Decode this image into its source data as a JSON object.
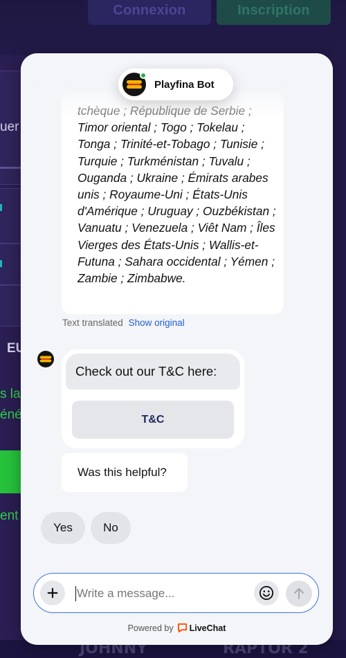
{
  "background": {
    "login_label": "Connexion",
    "signup_label": "Inscription",
    "left_fragments": [
      "uer",
      "EU",
      "s la",
      "éné",
      "ent"
    ],
    "bottom_words": [
      "JOHNNY",
      "RAPTOR 2"
    ]
  },
  "chat": {
    "bot_name": "Playfina Bot",
    "message_text_faded": "tchèque ; République de Serbie ;",
    "message_text": "Timor oriental ; Togo ; Tokelau ; Tonga ; Trinité-et-Tobago ; Tunisie ; Turquie ; Turkménistan ; Tuvalu ; Ouganda ; Ukraine ; Émirats arabes unis ; Royaume-Uni ; États-Unis d'Amérique ; Uruguay ; Ouzbékistan ; Vanuatu ; Venezuela ; Viêt Nam ; Îles Vierges des États-Unis ; Wallis-et-Futuna ; Sahara occidental ; Yémen ; Zambie ; Zimbabwe.",
    "translated_label": "Text translated",
    "show_original_label": "Show original",
    "tc_message": "Check out our T&C here:",
    "tc_button_label": "T&C",
    "helpful_question": "Was this helpful?",
    "quick_replies": [
      "Yes",
      "No"
    ],
    "composer_placeholder": "Write a message...",
    "powered_by_label": "Powered by",
    "powered_by_brand": "LiveChat"
  },
  "colors": {
    "accent_blue": "#3b73d9",
    "online_green": "#27b04a",
    "livechat_orange": "#ff5100"
  }
}
